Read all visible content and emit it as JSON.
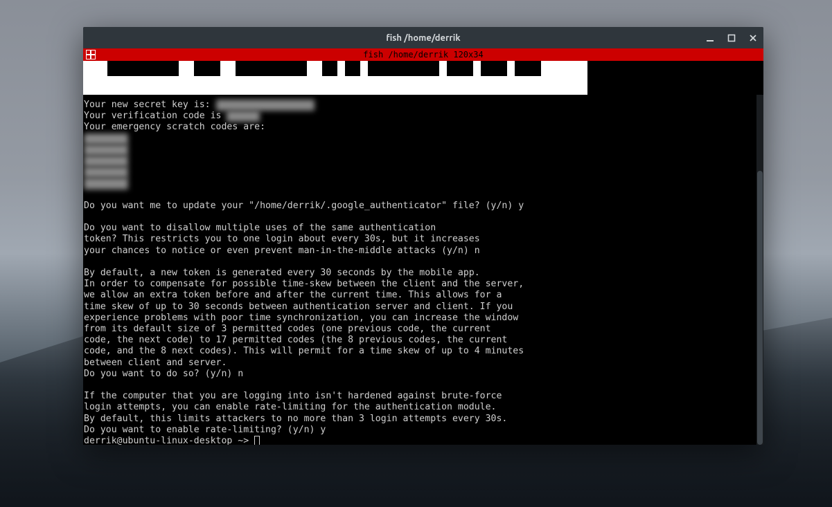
{
  "window": {
    "title": "fish  /home/derrik"
  },
  "tab": {
    "label": "fish  /home/derrik 120x34"
  },
  "output": {
    "secret_key_label": "Your new secret key is: ",
    "secret_key_value": "XX XXXX XXXXXXXXXX",
    "verification_label": "Your verification code is ",
    "verification_value": "XXXXXX",
    "scratch_label": "Your emergency scratch codes are:",
    "scratch_codes": [
      "  XXXXXX",
      "  XXXXXX",
      "  XXXXXX",
      "  XXXXXX",
      "  XXXXXX"
    ],
    "q1": "Do you want me to update your \"/home/derrik/.google_authenticator\" file? (y/n) y",
    "q2a": "Do you want to disallow multiple uses of the same authentication",
    "q2b": "token? This restricts you to one login about every 30s, but it increases",
    "q2c": "your chances to notice or even prevent man-in-the-middle attacks (y/n) n",
    "p3a": "By default, a new token is generated every 30 seconds by the mobile app.",
    "p3b": "In order to compensate for possible time-skew between the client and the server,",
    "p3c": "we allow an extra token before and after the current time. This allows for a",
    "p3d": "time skew of up to 30 seconds between authentication server and client. If you",
    "p3e": "experience problems with poor time synchronization, you can increase the window",
    "p3f": "from its default size of 3 permitted codes (one previous code, the current",
    "p3g": "code, the next code) to 17 permitted codes (the 8 previous codes, the current",
    "p3h": "code, and the 8 next codes). This will permit for a time skew of up to 4 minutes",
    "p3i": "between client and server.",
    "q3": "Do you want to do so? (y/n) n",
    "p4a": "If the computer that you are logging into isn't hardened against brute-force",
    "p4b": "login attempts, you can enable rate-limiting for the authentication module.",
    "p4c": "By default, this limits attackers to no more than 3 login attempts every 30s.",
    "q4": "Do you want to enable rate-limiting? (y/n) y",
    "prompt": "derrik@ubuntu-linux-desktop ~> "
  }
}
